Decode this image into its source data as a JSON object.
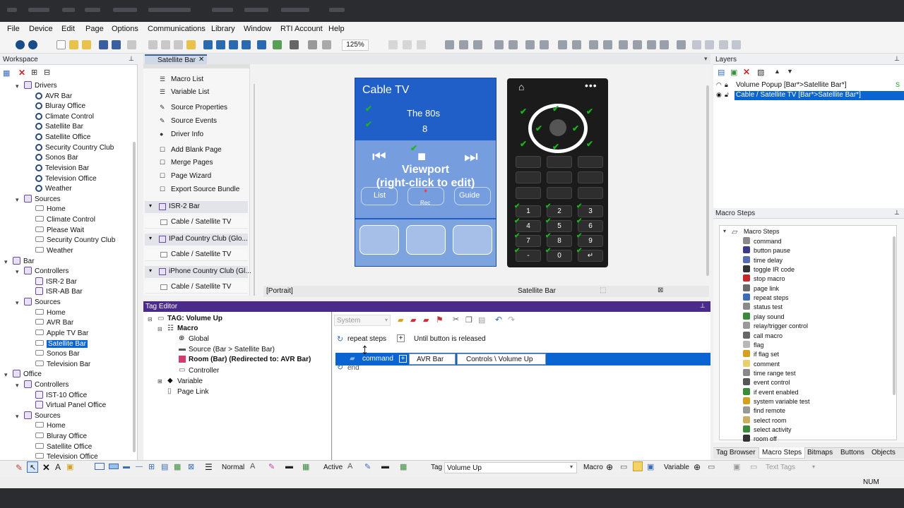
{
  "menu": [
    "File",
    "Device",
    "Edit",
    "Page",
    "Options",
    "Communications",
    "Library",
    "Window",
    "RTI Account",
    "Help"
  ],
  "zoom": "125%",
  "workspace": {
    "title": "Workspace",
    "tree": [
      {
        "label": "Drivers",
        "level": 1,
        "type": "folder"
      },
      {
        "label": "AVR Bar",
        "level": 2,
        "type": "gear"
      },
      {
        "label": "Bluray Office",
        "level": 2,
        "type": "gear"
      },
      {
        "label": "Climate Control",
        "level": 2,
        "type": "gear"
      },
      {
        "label": "Satellite Bar",
        "level": 2,
        "type": "gear"
      },
      {
        "label": "Satellite Office",
        "level": 2,
        "type": "gear"
      },
      {
        "label": "Security Country Club",
        "level": 2,
        "type": "gear"
      },
      {
        "label": "Sonos Bar",
        "level": 2,
        "type": "gear"
      },
      {
        "label": "Television Bar",
        "level": 2,
        "type": "gear"
      },
      {
        "label": "Television Office",
        "level": 2,
        "type": "gear"
      },
      {
        "label": "Weather",
        "level": 2,
        "type": "gear"
      },
      {
        "label": "Sources",
        "level": 1,
        "type": "folder"
      },
      {
        "label": "Home",
        "level": 2,
        "type": "page"
      },
      {
        "label": "Climate Control",
        "level": 2,
        "type": "page"
      },
      {
        "label": "Please Wait",
        "level": 2,
        "type": "page"
      },
      {
        "label": "Security Country Club",
        "level": 2,
        "type": "page"
      },
      {
        "label": "Weather",
        "level": 2,
        "type": "page"
      },
      {
        "label": "Bar",
        "level": 0,
        "type": "folder"
      },
      {
        "label": "Controllers",
        "level": 1,
        "type": "folder"
      },
      {
        "label": "ISR-2 Bar",
        "level": 2,
        "type": "device"
      },
      {
        "label": "ISR-AB Bar",
        "level": 2,
        "type": "device"
      },
      {
        "label": "Sources",
        "level": 1,
        "type": "folder"
      },
      {
        "label": "Home",
        "level": 2,
        "type": "page"
      },
      {
        "label": "AVR Bar",
        "level": 2,
        "type": "page"
      },
      {
        "label": "Apple TV Bar",
        "level": 2,
        "type": "page"
      },
      {
        "label": "Satellite Bar",
        "level": 2,
        "type": "page",
        "selected": true
      },
      {
        "label": "Sonos Bar",
        "level": 2,
        "type": "page"
      },
      {
        "label": "Television Bar",
        "level": 2,
        "type": "page"
      },
      {
        "label": "Office",
        "level": 0,
        "type": "folder"
      },
      {
        "label": "Controllers",
        "level": 1,
        "type": "folder"
      },
      {
        "label": "IST-10 Office",
        "level": 2,
        "type": "device"
      },
      {
        "label": "Virtual Panel Office",
        "level": 2,
        "type": "device"
      },
      {
        "label": "Sources",
        "level": 1,
        "type": "folder"
      },
      {
        "label": "Home",
        "level": 2,
        "type": "page"
      },
      {
        "label": "Bluray Office",
        "level": 2,
        "type": "page"
      },
      {
        "label": "Satellite Office",
        "level": 2,
        "type": "page"
      },
      {
        "label": "Television Office",
        "level": 2,
        "type": "page"
      }
    ]
  },
  "doc_tab": "Satellite Bar",
  "source_menu": {
    "items": [
      "Macro List",
      "Variable List",
      "Source Properties",
      "Source Events",
      "Driver Info",
      "Add Blank Page",
      "Merge Pages",
      "Page Wizard",
      "Export Source Bundle"
    ],
    "groups": [
      {
        "label": "ISR-2 Bar",
        "sub": "Cable / Satellite TV"
      },
      {
        "label": "IPad Country Club (Glo...",
        "sub": "Cable / Satellite TV"
      },
      {
        "label": "iPhone Country Club (Gl...",
        "sub": "Cable / Satellite TV"
      }
    ]
  },
  "preview": {
    "title": "Cable TV",
    "line1": "The 80s",
    "line2": "8",
    "viewport": "Viewport\n(right-click to edit)",
    "list": "List",
    "rec": "Rec",
    "guide": "Guide",
    "portrait": "[Portrait]",
    "bottom_label": "Satellite Bar",
    "remote_keys": [
      "1",
      "2",
      "3",
      "4",
      "5",
      "6",
      "7",
      "8",
      "9",
      "-",
      "0",
      "↵"
    ]
  },
  "layers": {
    "title": "Layers",
    "items": [
      "Volume Popup [Bar*>Satellite Bar*]",
      "Cable / Satellite TV [Bar*>Satellite Bar*]"
    ]
  },
  "macro_steps": {
    "title": "Macro Steps",
    "root": "Macro Steps",
    "items": [
      "command",
      "button pause",
      "time delay",
      "toggle IR code",
      "stop macro",
      "page link",
      "repeat steps",
      "status test",
      "play sound",
      "relay/trigger control",
      "call macro",
      "flag",
      "if flag set",
      "comment",
      "time range test",
      "event control",
      "if event enabled",
      "system variable test",
      "find remote",
      "select room",
      "select activity",
      "room off"
    ]
  },
  "tag_editor": {
    "title": "Tag Editor",
    "tag": "TAG: Volume Up",
    "tree": [
      "Macro",
      "Global",
      "Source (Bar > Satellite Bar)",
      "Room (Bar) (Redirected to: AVR Bar)",
      "Controller",
      "Variable",
      "Page Link"
    ],
    "system": "System",
    "repeat": "repeat steps",
    "repeat_cond": "Until button is released",
    "command": "command",
    "device": "AVR Bar",
    "command_value": "Controls \\ Volume Up",
    "end": "end"
  },
  "bottom_tabs": [
    "Tag Browser",
    "Macro Steps",
    "Bitmaps",
    "Buttons",
    "Objects"
  ],
  "footer": {
    "normal": "Normal",
    "active": "Active",
    "tag_label": "Tag",
    "tag_value": "Volume Up",
    "macro": "Macro",
    "variable": "Variable",
    "text_tags": "Text Tags",
    "num": "NUM"
  }
}
